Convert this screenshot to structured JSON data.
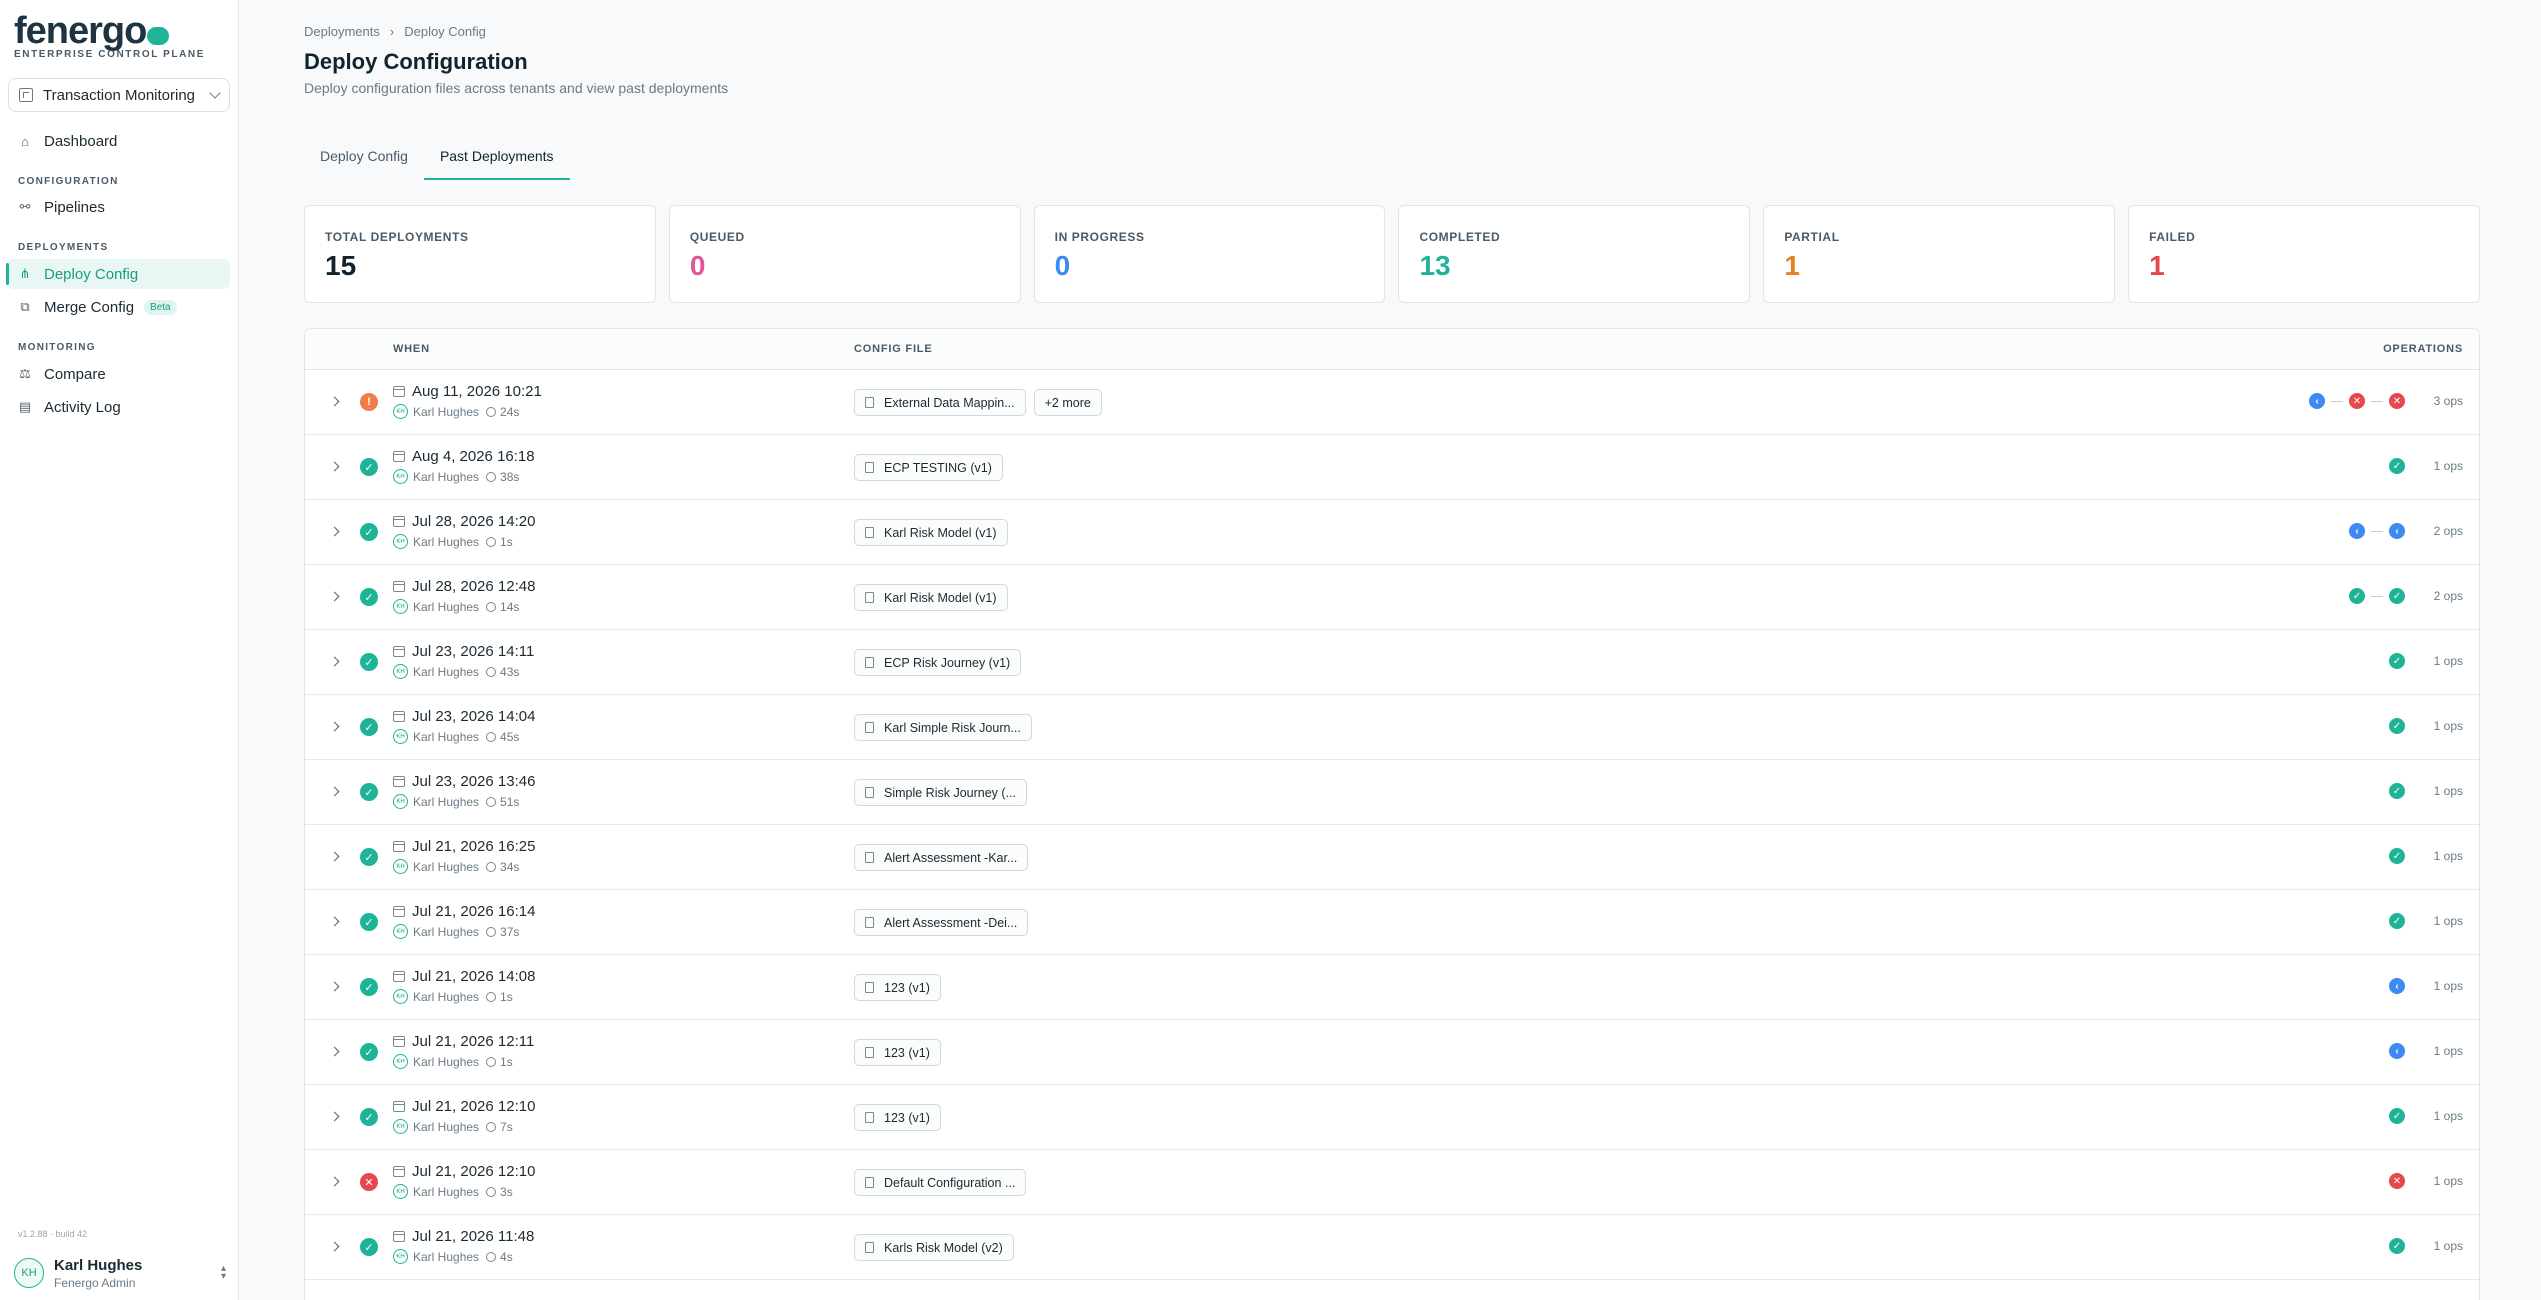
{
  "brand": {
    "logo": "fenergo",
    "subtitle": "ENTERPRISE CONTROL PLANE"
  },
  "tenant": {
    "name": "Transaction Monitoring"
  },
  "nav": {
    "dashboard": "Dashboard",
    "configuration_section": "CONFIGURATION",
    "pipelines": "Pipelines",
    "deployments_section": "DEPLOYMENTS",
    "deploy_config": "Deploy Config",
    "merge_config": "Merge Config",
    "merge_badge": "Beta",
    "monitoring_section": "MONITORING",
    "compare": "Compare",
    "activity_log": "Activity Log"
  },
  "footer": {
    "version": "v1.2.88 · build 42",
    "user_initials": "KH",
    "user_name": "Karl Hughes",
    "user_role": "Fenergo Admin"
  },
  "breadcrumb": {
    "parent": "Deployments",
    "sep": "›",
    "current": "Deploy Config"
  },
  "page": {
    "title": "Deploy Configuration",
    "subtitle": "Deploy configuration files across tenants and view past deployments"
  },
  "tabs": {
    "deploy": "Deploy Config",
    "past": "Past Deployments"
  },
  "stats": [
    {
      "label": "TOTAL DEPLOYMENTS",
      "value": "15",
      "color": "#12232e"
    },
    {
      "label": "QUEUED",
      "value": "0",
      "color": "#e0569b"
    },
    {
      "label": "IN PROGRESS",
      "value": "0",
      "color": "#3d8bf2"
    },
    {
      "label": "COMPLETED",
      "value": "13",
      "color": "#1fb497"
    },
    {
      "label": "PARTIAL",
      "value": "1",
      "color": "#e67e22"
    },
    {
      "label": "FAILED",
      "value": "1",
      "color": "#e5484d"
    }
  ],
  "table": {
    "headers": {
      "when": "WHEN",
      "config": "CONFIG FILE",
      "operations": "OPERATIONS"
    },
    "rows": [
      {
        "status": "partial",
        "date": "Aug 11, 2026 10:21",
        "user": "Karl Hughes",
        "duration": "24s",
        "files": [
          "External Data Mappin...",
          "+2 more"
        ],
        "ops": [
          "info",
          "fail",
          "fail"
        ],
        "ops_count": "3 ops"
      },
      {
        "status": "ok",
        "date": "Aug 4, 2026 16:18",
        "user": "Karl Hughes",
        "duration": "38s",
        "files": [
          "ECP TESTING (v1)"
        ],
        "ops": [
          "ok"
        ],
        "ops_count": "1 ops"
      },
      {
        "status": "ok",
        "date": "Jul 28, 2026 14:20",
        "user": "Karl Hughes",
        "duration": "1s",
        "files": [
          "Karl Risk Model (v1)"
        ],
        "ops": [
          "info",
          "info"
        ],
        "ops_count": "2 ops"
      },
      {
        "status": "ok",
        "date": "Jul 28, 2026 12:48",
        "user": "Karl Hughes",
        "duration": "14s",
        "files": [
          "Karl Risk Model (v1)"
        ],
        "ops": [
          "ok",
          "ok"
        ],
        "ops_count": "2 ops"
      },
      {
        "status": "ok",
        "date": "Jul 23, 2026 14:11",
        "user": "Karl Hughes",
        "duration": "43s",
        "files": [
          "ECP Risk Journey (v1)"
        ],
        "ops": [
          "ok"
        ],
        "ops_count": "1 ops"
      },
      {
        "status": "ok",
        "date": "Jul 23, 2026 14:04",
        "user": "Karl Hughes",
        "duration": "45s",
        "files": [
          "Karl Simple Risk Journ..."
        ],
        "ops": [
          "ok"
        ],
        "ops_count": "1 ops"
      },
      {
        "status": "ok",
        "date": "Jul 23, 2026 13:46",
        "user": "Karl Hughes",
        "duration": "51s",
        "files": [
          "Simple Risk Journey (..."
        ],
        "ops": [
          "ok"
        ],
        "ops_count": "1 ops"
      },
      {
        "status": "ok",
        "date": "Jul 21, 2026 16:25",
        "user": "Karl Hughes",
        "duration": "34s",
        "files": [
          "Alert Assessment -Kar..."
        ],
        "ops": [
          "ok"
        ],
        "ops_count": "1 ops"
      },
      {
        "status": "ok",
        "date": "Jul 21, 2026 16:14",
        "user": "Karl Hughes",
        "duration": "37s",
        "files": [
          "Alert Assessment -Dei..."
        ],
        "ops": [
          "ok"
        ],
        "ops_count": "1 ops"
      },
      {
        "status": "ok",
        "date": "Jul 21, 2026 14:08",
        "user": "Karl Hughes",
        "duration": "1s",
        "files": [
          "123 (v1)"
        ],
        "ops": [
          "info"
        ],
        "ops_count": "1 ops"
      },
      {
        "status": "ok",
        "date": "Jul 21, 2026 12:11",
        "user": "Karl Hughes",
        "duration": "1s",
        "files": [
          "123 (v1)"
        ],
        "ops": [
          "info"
        ],
        "ops_count": "1 ops"
      },
      {
        "status": "ok",
        "date": "Jul 21, 2026 12:10",
        "user": "Karl Hughes",
        "duration": "7s",
        "files": [
          "123 (v1)"
        ],
        "ops": [
          "ok"
        ],
        "ops_count": "1 ops"
      },
      {
        "status": "fail",
        "date": "Jul 21, 2026 12:10",
        "user": "Karl Hughes",
        "duration": "3s",
        "files": [
          "Default Configuration ..."
        ],
        "ops": [
          "fail"
        ],
        "ops_count": "1 ops"
      },
      {
        "status": "ok",
        "date": "Jul 21, 2026 11:48",
        "user": "Karl Hughes",
        "duration": "4s",
        "files": [
          "Karls Risk Model (v2)"
        ],
        "ops": [
          "ok"
        ],
        "ops_count": "1 ops"
      }
    ]
  }
}
